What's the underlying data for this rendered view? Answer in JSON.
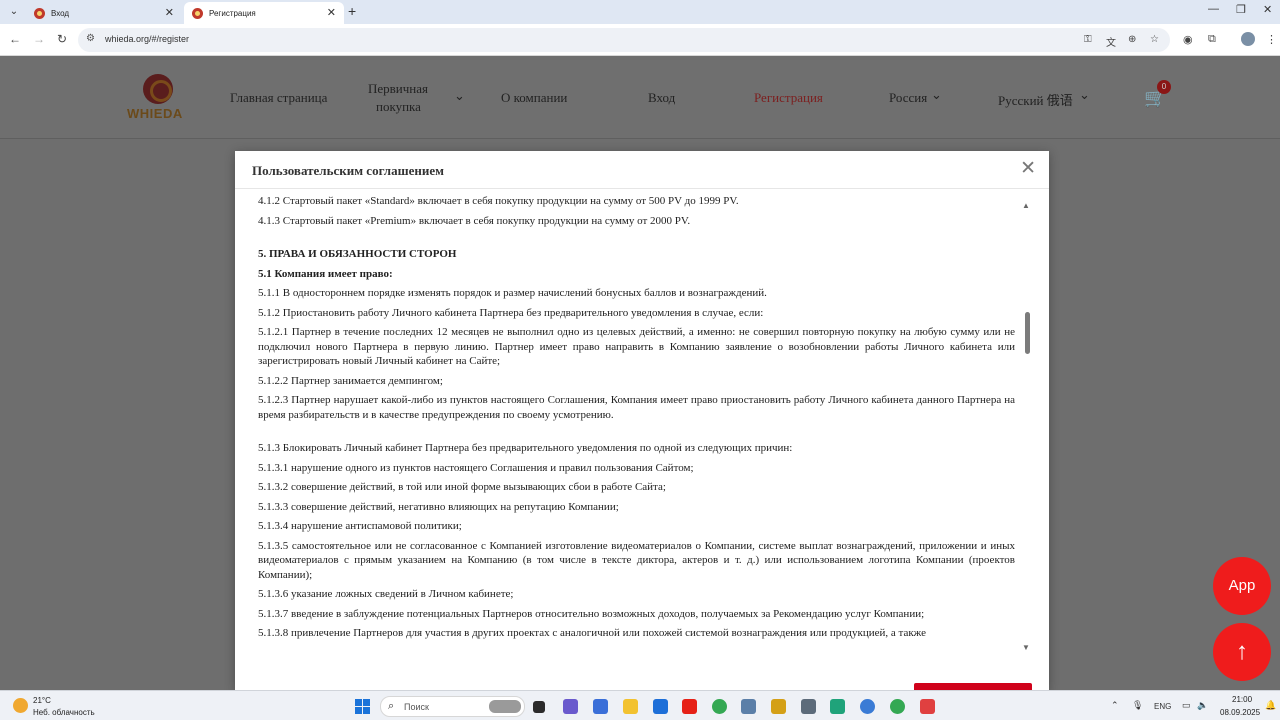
{
  "browser": {
    "tabs": [
      {
        "title": "Вход",
        "active": false
      },
      {
        "title": "Регистрация",
        "active": true
      }
    ],
    "url": "whieda.org/#/register"
  },
  "site": {
    "logo_text": "WHIEDA",
    "nav": [
      {
        "label": "Главная страница"
      },
      {
        "label": "Первичная"
      },
      {
        "label": "покупка"
      },
      {
        "label": "О компании"
      },
      {
        "label": "Вход"
      },
      {
        "label": "Регистрация"
      },
      {
        "label": "Россия"
      },
      {
        "label": "Русский 俄语"
      }
    ],
    "cart_count": "0",
    "accent": "#d0021b"
  },
  "modal": {
    "title": "Пользовательским соглашением",
    "paragraphs": [
      {
        "text": "4.1.2 Стартовый пакет «Standard» включает в себя покупку продукции на сумму от 500 PV до 1999 PV."
      },
      {
        "text": "4.1.3 Стартовый пакет «Premium» включает в себя покупку продукции на сумму от 2000 PV."
      },
      {
        "text": "5. ПРАВА И ОБЯЗАННОСТИ СТОРОН"
      },
      {
        "text": "5.1 Компания имеет право:"
      },
      {
        "text": "5.1.1 В одностороннем порядке изменять порядок и размер начислений бонусных баллов и вознаграждений."
      },
      {
        "text": "5.1.2 Приостановить работу Личного кабинета Партнера без предварительного уведомления в случае, если:"
      },
      {
        "text": "5.1.2.1 Партнер в течение последних 12 месяцев не выполнил одно из целевых действий, а именно: не совершил повторную покупку на любую сумму или не подключил нового Партнера в первую линию. Партнер имеет право направить в Компанию заявление о возобновлении работы Личного кабинета или зарегистрировать новый Личный кабинет на Сайте;"
      },
      {
        "text": "5.1.2.2 Партнер занимается демпингом;"
      },
      {
        "text": "5.1.2.3 Партнер нарушает какой-либо из пунктов настоящего Соглашения, Компания имеет право приостановить работу Личного кабинета данного Партнера на время разбирательств и в качестве предупреждения по своему усмотрению."
      },
      {
        "text": "5.1.3 Блокировать Личный кабинет Партнера без предварительного уведомления по одной из следующих причин:"
      },
      {
        "text": "5.1.3.1 нарушение одного из пунктов настоящего Соглашения и правил пользования Сайтом;"
      },
      {
        "text": "5.1.3.2 совершение действий, в той или иной форме вызывающих сбои в работе Сайта;"
      },
      {
        "text": "5.1.3.3 совершение действий, негативно влияющих на репутацию Компании;"
      },
      {
        "text": "5.1.3.4 нарушение антиспамовой политики;"
      },
      {
        "text": "5.1.3.5 самостоятельное или не согласованное с Компанией изготовление видеоматериалов о Компании, системе выплат вознаграждений, приложении и иных видеоматериалов с прямым указанием на Компанию (в том числе в тексте диктора, актеров и т. д.) или использованием логотипа Компании (проектов Компании);"
      },
      {
        "text": "5.1.3.6 указание ложных сведений в Личном кабинете;"
      },
      {
        "text": "5.1.3.7 введение в заблуждение потенциальных Партнеров относительно возможных доходов, получаемых за Рекомендацию услуг Компании;"
      },
      {
        "text": "5.1.3.8 привлечение Партнеров для участия в других проектах с аналогичной или похожей системой вознаграждения или продукцией, а также"
      }
    ]
  },
  "floating": {
    "app_label": "App",
    "up_icon": "arrow-up-icon"
  },
  "taskbar": {
    "weather_temp": "21°C",
    "weather_desc": "Неб. облачность",
    "search_placeholder": "Поиск",
    "lang": "ENG",
    "time": "21:00",
    "date": "08.09.2025"
  }
}
